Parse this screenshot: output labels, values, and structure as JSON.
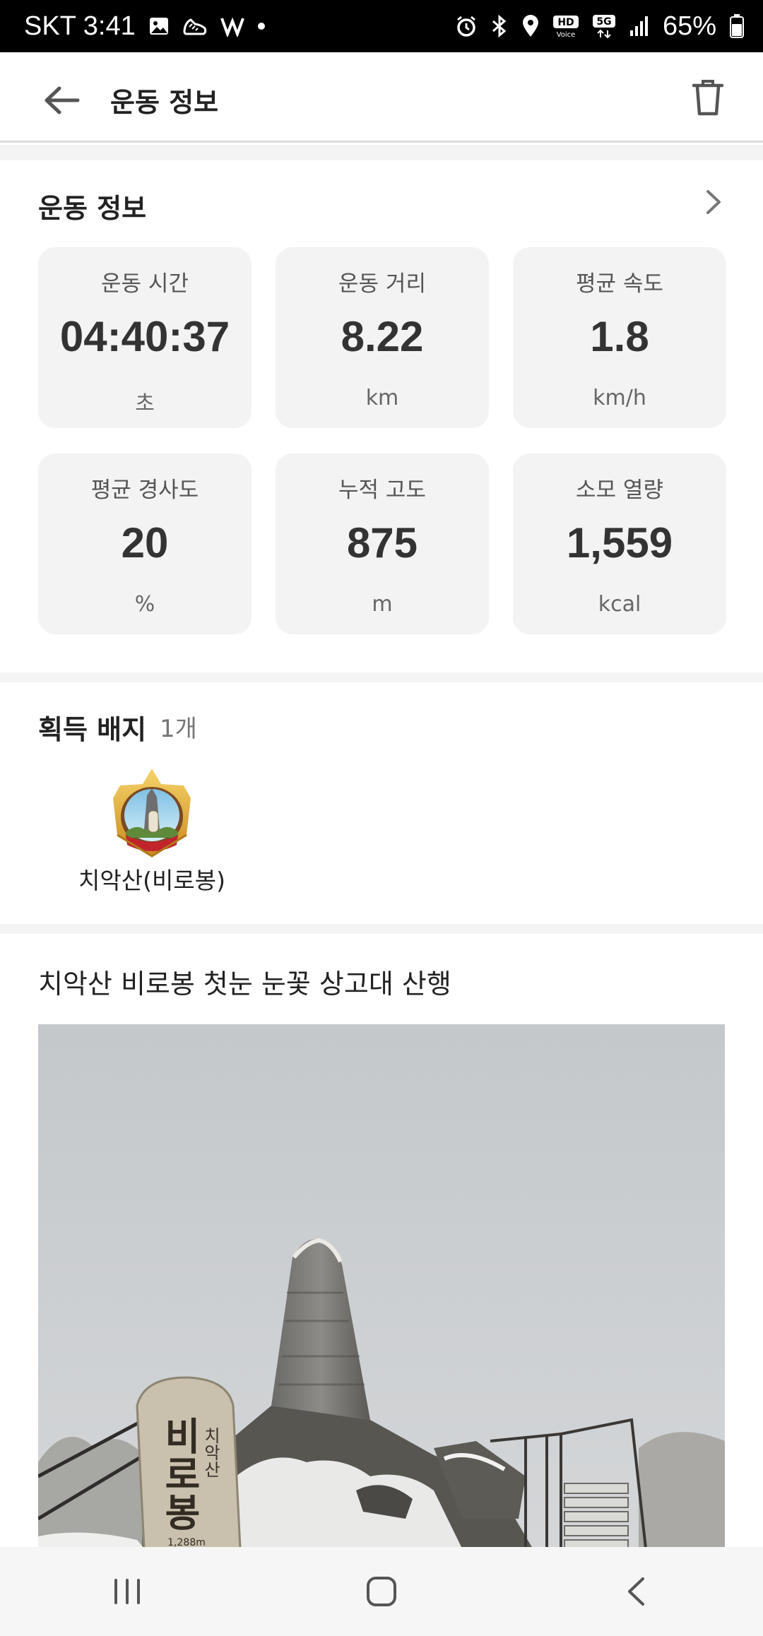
{
  "status_bar": {
    "carrier_time": "SKT 3:41",
    "battery_percent": "65%",
    "icons": [
      "gallery-icon",
      "shoe-icon",
      "app-icon",
      "dot-icon",
      "alarm-icon",
      "bluetooth-icon",
      "location-icon",
      "hd-voice-icon",
      "5g-icon",
      "signal-icon",
      "battery-icon"
    ]
  },
  "header": {
    "title": "운동 정보",
    "back_icon": "arrow-left-icon",
    "delete_icon": "trash-icon"
  },
  "workout": {
    "title": "운동 정보",
    "stats": [
      {
        "label": "운동 시간",
        "value": "04:40:37",
        "unit": "초"
      },
      {
        "label": "운동 거리",
        "value": "8.22",
        "unit": "km"
      },
      {
        "label": "평균 속도",
        "value": "1.8",
        "unit": "km/h"
      },
      {
        "label": "평균 경사도",
        "value": "20",
        "unit": "%"
      },
      {
        "label": "누적 고도",
        "value": "875",
        "unit": "m"
      },
      {
        "label": "소모 열량",
        "value": "1,559",
        "unit": "kcal"
      }
    ]
  },
  "badges": {
    "title": "획득 배지",
    "count": "1개",
    "items": [
      {
        "name": "치악산(비로봉)"
      }
    ]
  },
  "post": {
    "title": "치악산 비로봉 첫눈 눈꽃 상고대 산행",
    "photo_signs": [
      "치악산",
      "비로봉",
      "1,288m"
    ]
  },
  "nav_bar": {
    "icons": [
      "recent-apps-icon",
      "home-icon",
      "back-icon"
    ]
  },
  "colors": {
    "card_bg": "#f3f3f3",
    "divider": "#f4f4f4",
    "text": "#222222"
  }
}
